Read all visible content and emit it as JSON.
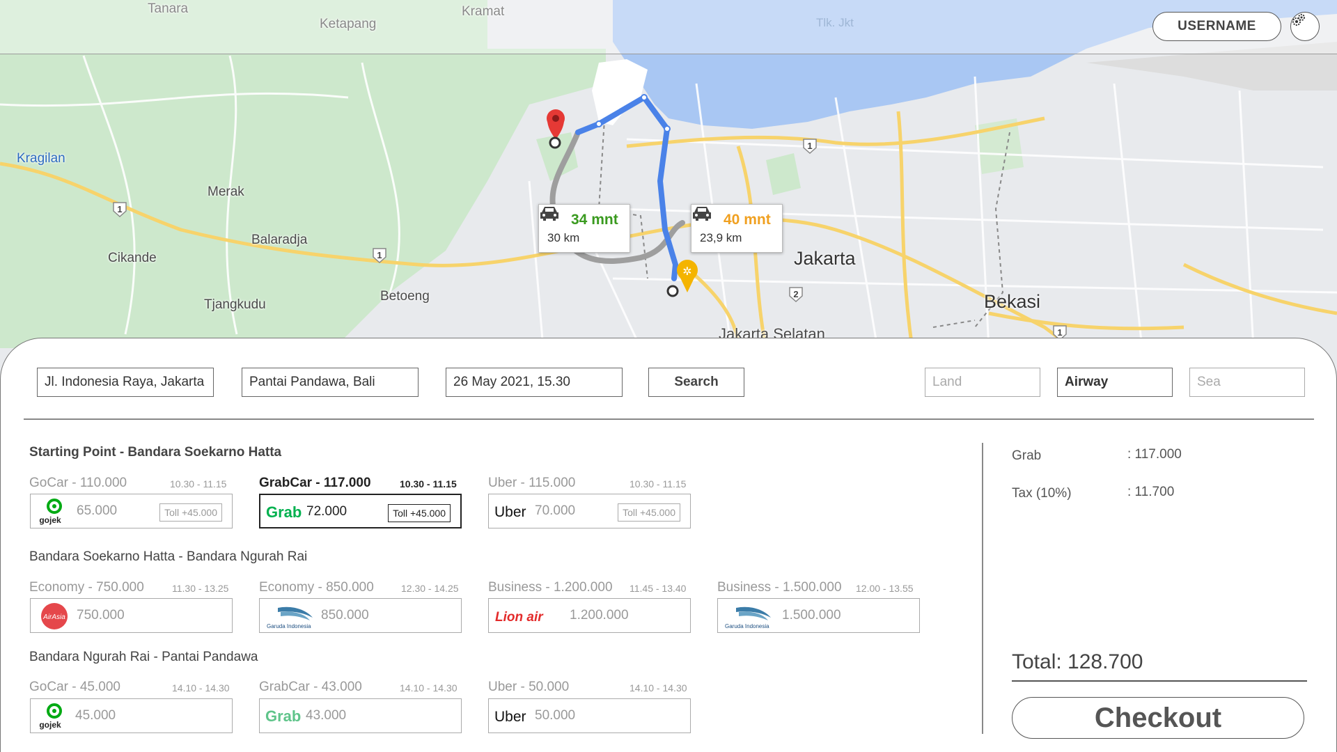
{
  "header": {
    "username_label": "USERNAME",
    "settings_icon": "settings-icon"
  },
  "map": {
    "labels": {
      "tanara": "Tanara",
      "ketapang": "Ketapang",
      "kramat": "Kramat",
      "tlk_jkt": "Tlk. Jkt",
      "kragilan": "Kragilan",
      "merak": "Merak",
      "balaradja": "Balaradja",
      "cikande": "Cikande",
      "tjangkudu": "Tjangkudu",
      "betoeng": "Betoeng",
      "jakarta": "Jakarta",
      "bekasi": "Bekasi",
      "jakarta_selatan": "Jakarta Selatan"
    },
    "routes": [
      {
        "mins": "34 mnt",
        "km": "30 km",
        "color": "#3a9a1f"
      },
      {
        "mins": "40 mnt",
        "km": "23,9 km",
        "color": "#f0a020"
      }
    ],
    "road_badges": [
      "1",
      "1",
      "1",
      "2",
      "1"
    ]
  },
  "search": {
    "origin": "Jl. Indonesia Raya, Jakarta",
    "destination": "Pantai Pandawa, Bali",
    "datetime": "26 May 2021, 15.30",
    "search_label": "Search",
    "modes": [
      "Land",
      "Airway",
      "Sea"
    ]
  },
  "sections": [
    {
      "title": "Starting Point - Bandara Soekarno Hatta",
      "options": [
        {
          "head": "GoCar - 110.000",
          "time": "10.30 - 11.15",
          "price": "65.000",
          "toll": "Toll +45.000",
          "logo": "gojek"
        },
        {
          "head": "GrabCar - 117.000",
          "time": "10.30 - 11.15",
          "price": "72.000",
          "toll": "Toll +45.000",
          "logo": "grab"
        },
        {
          "head": "Uber - 115.000",
          "time": "10.30 - 11.15",
          "price": "70.000",
          "toll": "Toll +45.000",
          "logo": "uber"
        }
      ]
    },
    {
      "title": "Bandara Soekarno Hatta - Bandara Ngurah Rai",
      "options": [
        {
          "head": "Economy - 750.000",
          "time": "11.30 - 13.25",
          "price": "750.000",
          "logo": "airasia"
        },
        {
          "head": "Economy - 850.000",
          "time": "12.30 - 14.25",
          "price": "850.000",
          "logo": "garuda"
        },
        {
          "head": "Business - 1.200.000",
          "time": "11.45 - 13.40",
          "price": "1.200.000",
          "logo": "lionair"
        },
        {
          "head": "Business - 1.500.000",
          "time": "12.00 - 13.55",
          "price": "1.500.000",
          "logo": "garuda"
        }
      ]
    },
    {
      "title": "Bandara Ngurah Rai - Pantai Pandawa",
      "options": [
        {
          "head": "GoCar - 45.000",
          "time": "14.10 - 14.30",
          "price": "45.000",
          "logo": "gojek"
        },
        {
          "head": "GrabCar - 43.000",
          "time": "14.10 - 14.30",
          "price": "43.000",
          "logo": "grab"
        },
        {
          "head": "Uber - 50.000",
          "time": "14.10 - 14.30",
          "price": "50.000",
          "logo": "uber"
        }
      ]
    }
  ],
  "logos": {
    "gojek": "gojek",
    "grab": "Grab",
    "uber": "Uber",
    "airasia": "AirAsia",
    "garuda": "Garuda Indonesia",
    "lionair": "Lion air"
  },
  "summary": {
    "lines": [
      {
        "label": "Grab",
        "value": ": 117.000"
      },
      {
        "label": "Tax (10%)",
        "value": ": 11.700"
      }
    ],
    "total": "Total: 128.700",
    "checkout_label": "Checkout"
  }
}
